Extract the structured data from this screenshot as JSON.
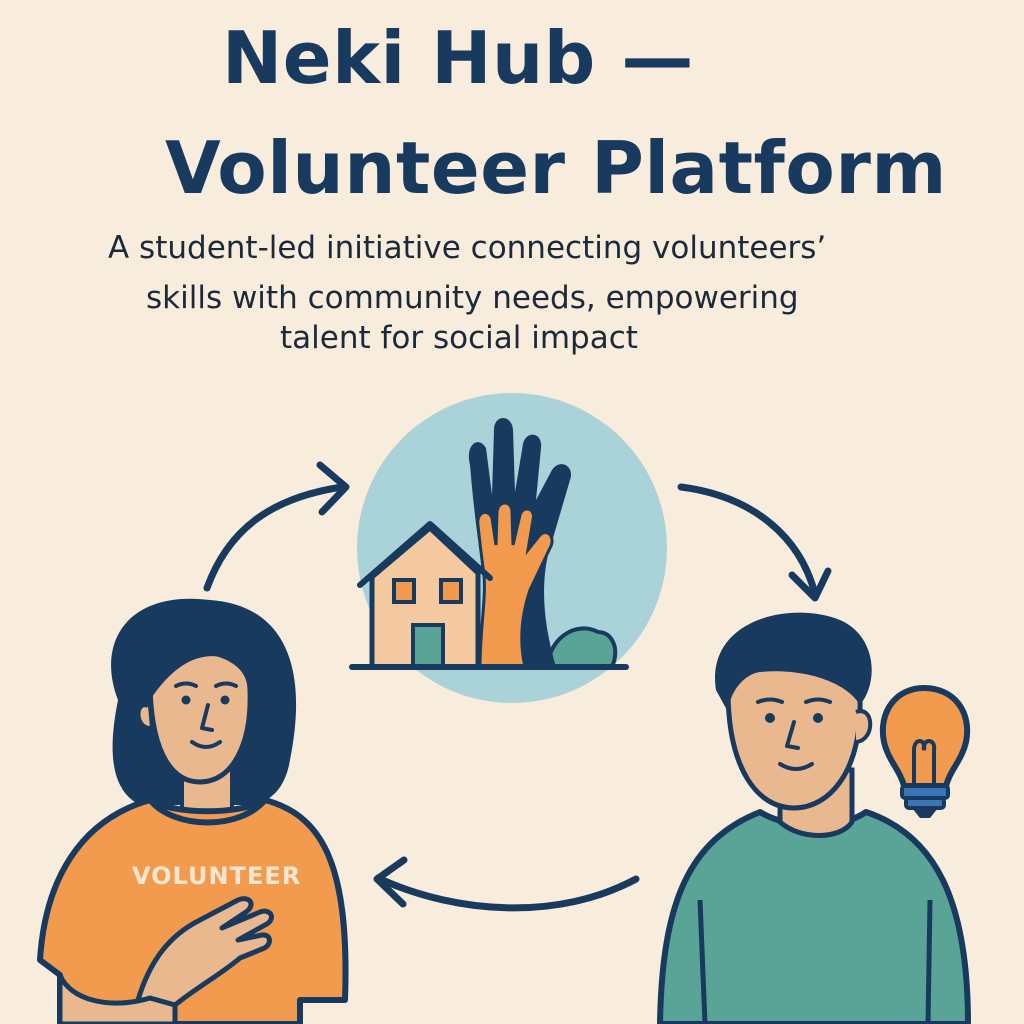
{
  "header": {
    "title_line_1": "Neki Hub —",
    "title_line_2": "Volunteer Platform",
    "subtitle_line_1": "A student-led initiative connecting volunteers’",
    "subtitle_line_2": "skills with community needs, empowering",
    "subtitle_line_3": "talent for social impact"
  },
  "illustration": {
    "volunteer_shirt_label": "VOLUNTEER"
  },
  "colors": {
    "background": "#f8ecdc",
    "navy": "#173a5e",
    "orange": "#f29b4e",
    "teal": "#5aa397",
    "light_blue": "#a9d3d8",
    "skin": "#e9b88e",
    "house": "#f5c9a0",
    "bulb_base": "#3c75b5"
  }
}
